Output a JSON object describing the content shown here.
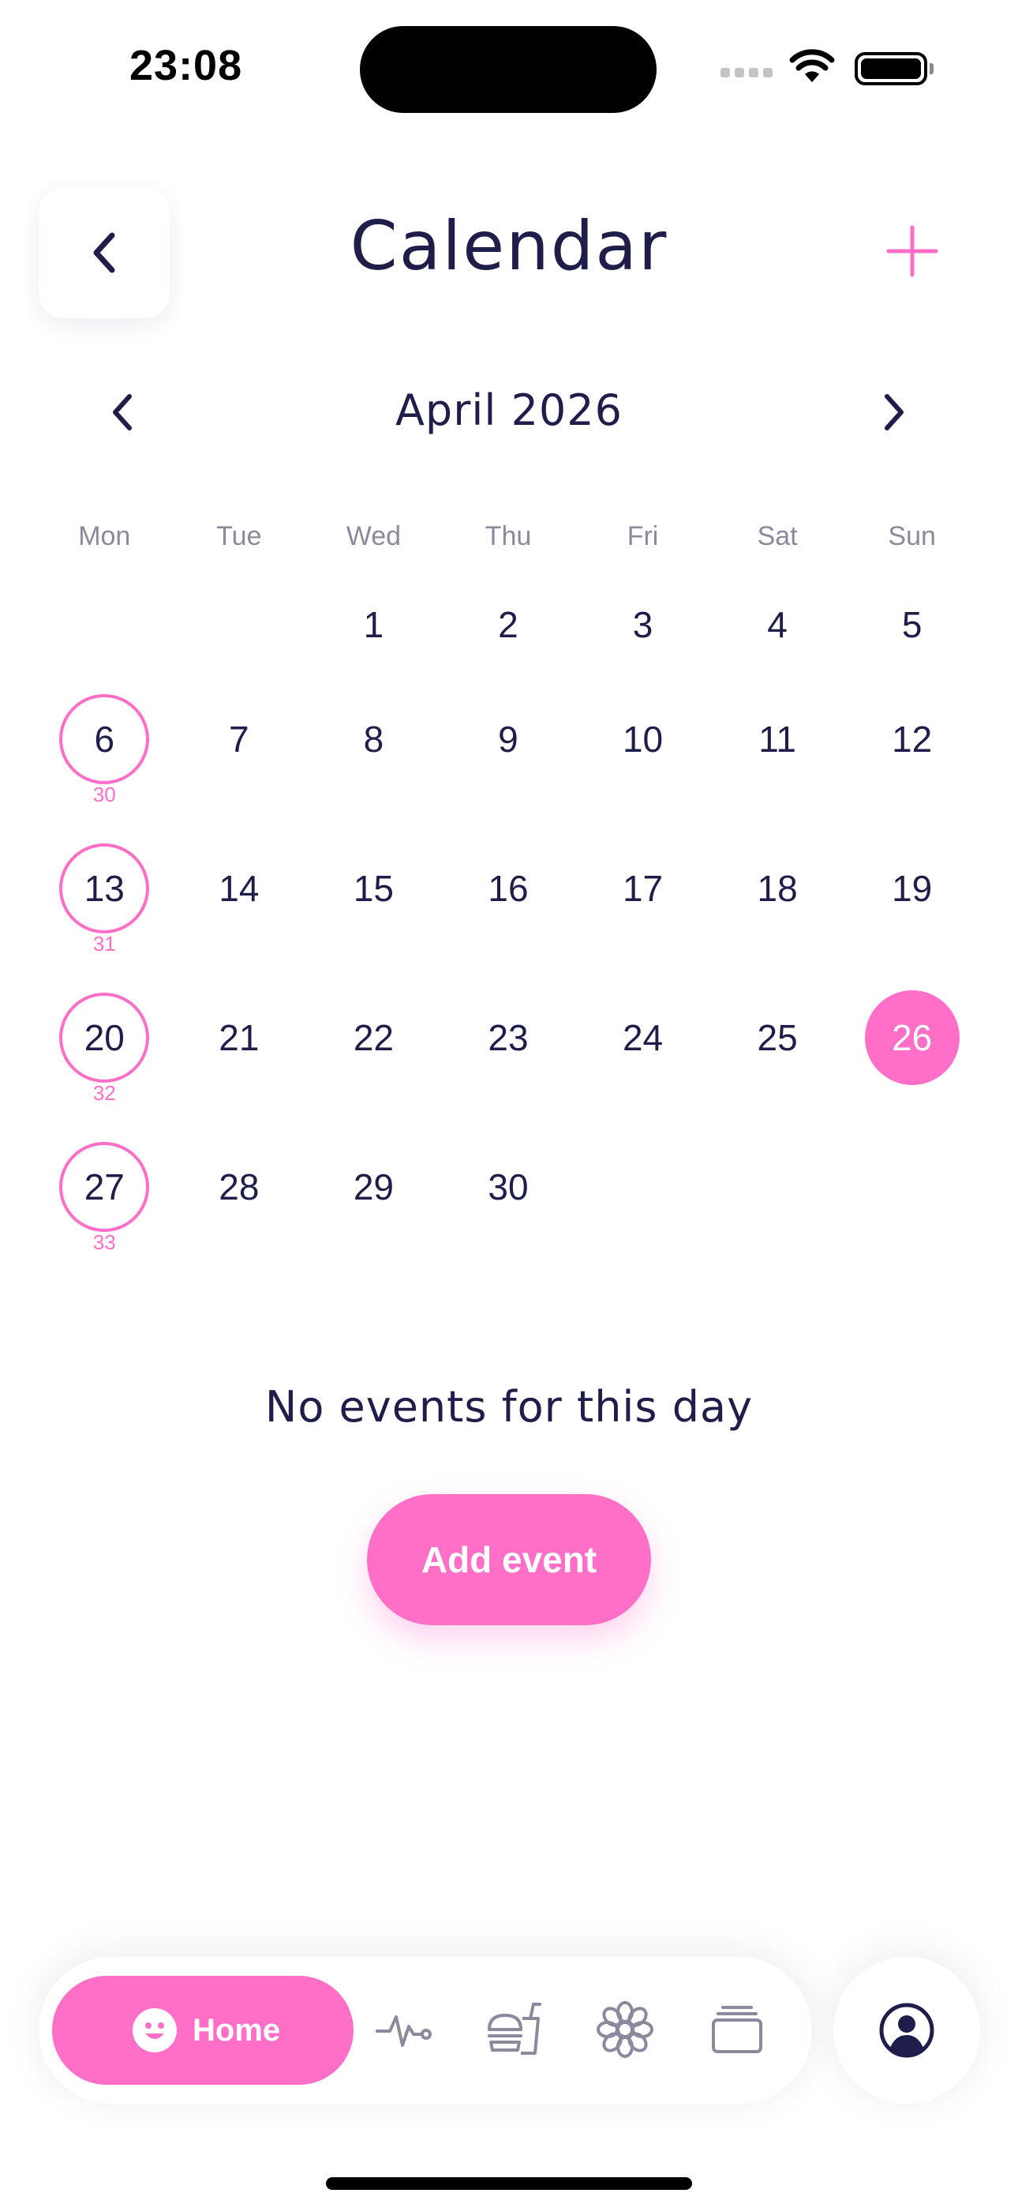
{
  "status_bar": {
    "time": "23:08"
  },
  "header": {
    "title": "Calendar"
  },
  "month_nav": {
    "label": "April 2026"
  },
  "weekdays": [
    "Mon",
    "Tue",
    "Wed",
    "Thu",
    "Fri",
    "Sat",
    "Sun"
  ],
  "calendar": {
    "rows": [
      [
        {
          "d": ""
        },
        {
          "d": ""
        },
        {
          "d": "1"
        },
        {
          "d": "2"
        },
        {
          "d": "3"
        },
        {
          "d": "4"
        },
        {
          "d": "5"
        }
      ],
      [
        {
          "d": "6",
          "week": "30"
        },
        {
          "d": "7"
        },
        {
          "d": "8"
        },
        {
          "d": "9"
        },
        {
          "d": "10"
        },
        {
          "d": "11"
        },
        {
          "d": "12"
        }
      ],
      [
        {
          "d": "13",
          "week": "31"
        },
        {
          "d": "14"
        },
        {
          "d": "15"
        },
        {
          "d": "16"
        },
        {
          "d": "17"
        },
        {
          "d": "18"
        },
        {
          "d": "19"
        }
      ],
      [
        {
          "d": "20",
          "week": "32"
        },
        {
          "d": "21"
        },
        {
          "d": "22"
        },
        {
          "d": "23"
        },
        {
          "d": "24"
        },
        {
          "d": "25"
        },
        {
          "d": "26"
        }
      ],
      [
        {
          "d": "27",
          "week": "33"
        },
        {
          "d": "28"
        },
        {
          "d": "29"
        },
        {
          "d": "30"
        },
        {
          "d": ""
        },
        {
          "d": ""
        },
        {
          "d": ""
        }
      ]
    ],
    "selected_day": "26"
  },
  "empty_state": {
    "message": "No events for this day",
    "button_label": "Add event"
  },
  "bottom_nav": {
    "items": [
      {
        "label": "Home",
        "icon": "smile-icon",
        "active": true
      },
      {
        "label": "",
        "icon": "pulse-icon"
      },
      {
        "label": "",
        "icon": "food-icon"
      },
      {
        "label": "",
        "icon": "flower-icon"
      },
      {
        "label": "",
        "icon": "cards-icon"
      }
    ],
    "profile_icon": "profile-icon"
  },
  "colors": {
    "accent": "#ff6ec7",
    "text_dark": "#1f1d4a",
    "text_muted": "#8b8a9c",
    "background": "#ffffff"
  }
}
